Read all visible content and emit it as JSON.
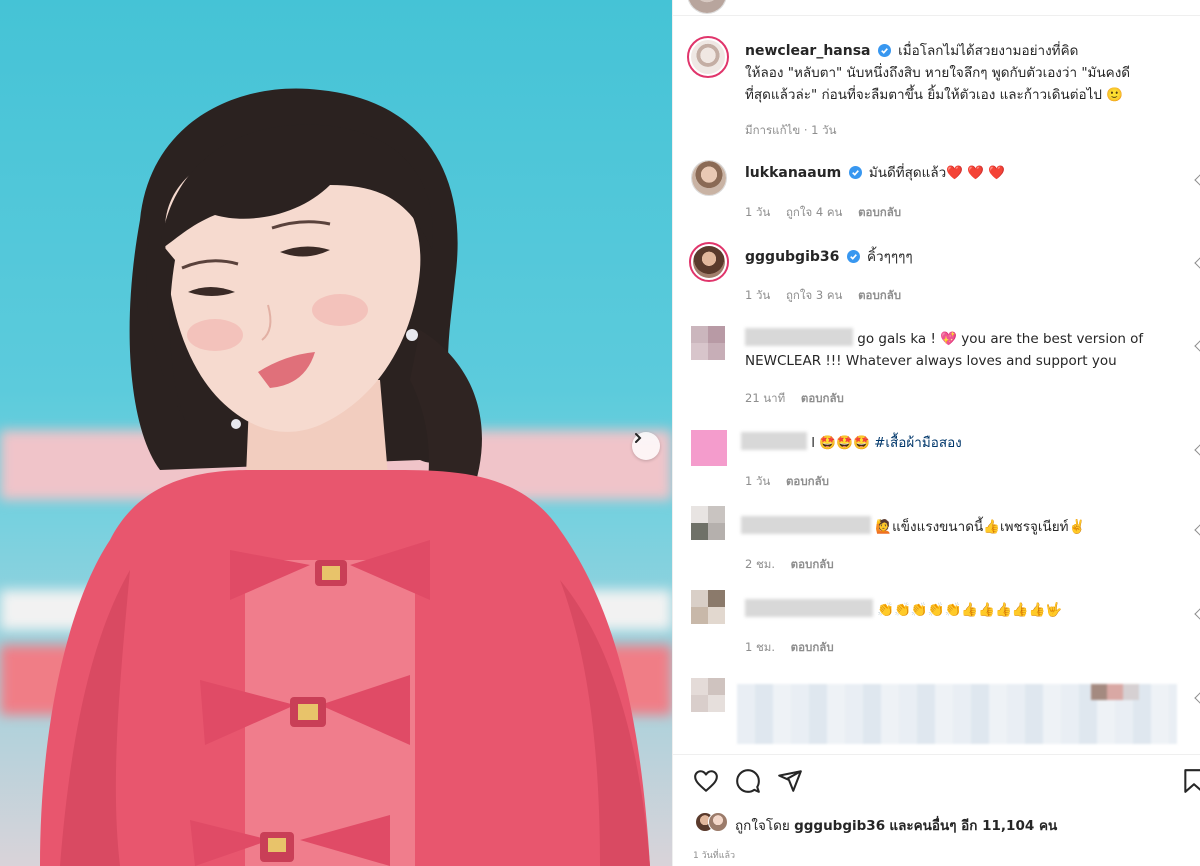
{
  "post": {
    "author": "newclear_hansa",
    "caption_line1": "เมื่อโลกไม่ได้สวยงามอย่างที่คิด",
    "caption_line2": "ให้ลอง \"หลับตา\" นับหนึ่งถึงสิบ หายใจลึกๆ พูดกับตัวเองว่า \"มันคงดี",
    "caption_line3": "ที่สุดแล้วล่ะ\" ก่อนที่จะลืมตาขึ้น ยิ้มให้ตัวเอง และก้าวเดินต่อไป 🙂",
    "edited_time": "มีการแก้ไข · 1 วัน"
  },
  "comments": [
    {
      "user": "lukkanaaum",
      "text": "มันดีที่สุดแล้ว❤️ ❤️ ❤️",
      "time": "1 วัน",
      "likes": "ถูกใจ 4 คน",
      "reply": "ตอบกลับ"
    },
    {
      "user": "gggubgib36",
      "text": "คิ้วๆๆๆๆ",
      "time": "1 วัน",
      "likes": "ถูกใจ 3 คน",
      "reply": "ตอบกลับ"
    },
    {
      "user": "",
      "text_line1": "go gals ka ! 💖 you are the best version of",
      "text_line2": "NEWCLEAR !!! Whatever always loves and support you",
      "time": "21 นาที",
      "reply": "ตอบกลับ"
    },
    {
      "user": "",
      "text": "l 🤩🤩🤩 #เสื้อผ้ามือสอง",
      "hashtag": "#เสื้อผ้ามือสอง",
      "time": "1 วัน",
      "reply": "ตอบกลับ"
    },
    {
      "user": "",
      "text": "🙋แข็งแรงขนาดนี้👍เพชรจูเนียท์✌️",
      "time": "2 ชม.",
      "reply": "ตอบกลับ"
    },
    {
      "user": "",
      "text": "👏👏👏👏👏👍👍👍👍👍🤟",
      "time": "1 ชม.",
      "reply": "ตอบกลับ"
    }
  ],
  "likes_line": {
    "prefix": "ถูกใจโดย",
    "user": "gggubgib36",
    "suffix": "และคนอื่นๆ อีก 11,104 คน"
  },
  "footer_time": "1 วันที่แล้ว",
  "icons": {
    "like": "heart-icon",
    "comment": "comment-icon",
    "share": "share-icon",
    "save": "bookmark-icon",
    "verified": "verified-badge-icon",
    "next": "chevron-right-icon"
  },
  "colors": {
    "verified": "#3897f0",
    "hashtag": "#00376b",
    "muted": "#8e8e8e",
    "heart": "#ed4956"
  }
}
